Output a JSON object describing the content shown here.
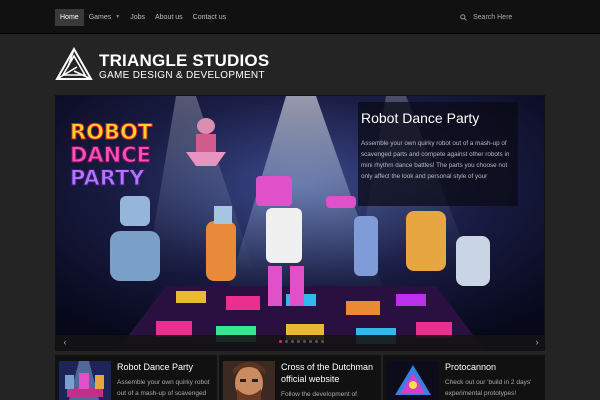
{
  "nav": {
    "items": [
      {
        "label": "Home",
        "active": true
      },
      {
        "label": "Games",
        "active": false,
        "has_dropdown": true
      },
      {
        "label": "Jobs",
        "active": false
      },
      {
        "label": "About us",
        "active": false
      },
      {
        "label": "Contact us",
        "active": false
      }
    ],
    "search_placeholder": "Search Here"
  },
  "logo": {
    "title": "TRIANGLE STUDIOS",
    "subtitle": "GAME DESIGN & DEVELOPMENT"
  },
  "slider": {
    "art_lettering": [
      "ROBOT",
      "DANCE",
      "PARTY"
    ],
    "caption_title": "Robot Dance Party",
    "caption_text": "Assemble your own quirky robot out of a mash-up of scavenged parts and compete against other robots in mini rhythm dance battles! The parts you choose not only affect the look and personal style of your",
    "dot_count": 8,
    "active_dot": 0,
    "prev_label": "‹",
    "next_label": "›"
  },
  "cards": [
    {
      "title": "Robot Dance Party",
      "text": "Assemble your own quirky robot out of a mash-up of scavenged"
    },
    {
      "title": "Cross of the Dutchman official website",
      "text": "Follow the development of"
    },
    {
      "title": "Protocannon",
      "text": "Check out our 'build in 2 days' experimental prototypes!"
    }
  ],
  "colors": {
    "accent": "#e0208a",
    "background": "#242424",
    "topbar": "#111111"
  }
}
